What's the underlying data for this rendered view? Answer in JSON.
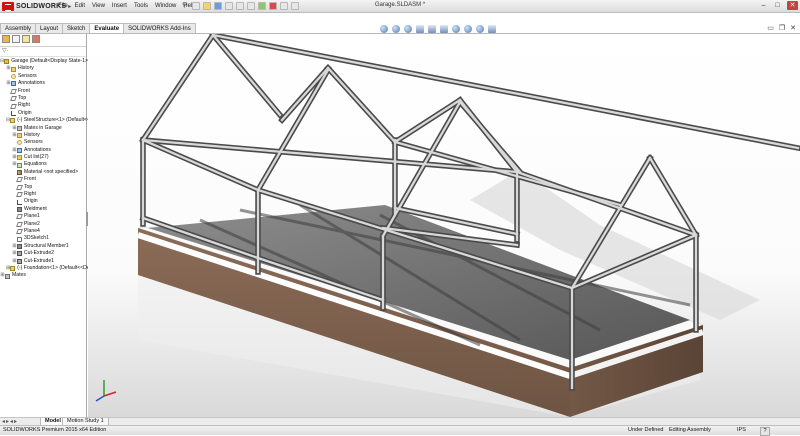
{
  "app": {
    "logo_text": "SOLIDWORKS",
    "document_title": "Garage.SLDASM *"
  },
  "menu": [
    "File",
    "Edit",
    "View",
    "Insert",
    "Tools",
    "Window",
    "Help"
  ],
  "command_tabs": [
    "Assembly",
    "Layout",
    "Sketch",
    "Evaluate",
    "SOLIDWORKS Add-Ins"
  ],
  "feature_tree": {
    "rows": [
      {
        "label": "Garage  (Default<Display State-1>)",
        "indent": 0,
        "icon": "asm",
        "toggle": "-"
      },
      {
        "label": "History",
        "indent": 1,
        "icon": "folder",
        "toggle": "+"
      },
      {
        "label": "Sensors",
        "indent": 1,
        "icon": "sensor",
        "toggle": ""
      },
      {
        "label": "Annotations",
        "indent": 1,
        "icon": "annot",
        "toggle": "+"
      },
      {
        "label": "Front",
        "indent": 1,
        "icon": "plane",
        "toggle": ""
      },
      {
        "label": "Top",
        "indent": 1,
        "icon": "plane",
        "toggle": ""
      },
      {
        "label": "Right",
        "indent": 1,
        "icon": "plane",
        "toggle": ""
      },
      {
        "label": "Origin",
        "indent": 1,
        "icon": "origin",
        "toggle": ""
      },
      {
        "label": "(-) SteelStructure<1> (Default<<Defa",
        "indent": 1,
        "icon": "part",
        "toggle": "-"
      },
      {
        "label": "Mates in Garage",
        "indent": 2,
        "icon": "mates",
        "toggle": "+"
      },
      {
        "label": "History",
        "indent": 2,
        "icon": "folder",
        "toggle": "+"
      },
      {
        "label": "Sensors",
        "indent": 2,
        "icon": "sensor",
        "toggle": ""
      },
      {
        "label": "Annotations",
        "indent": 2,
        "icon": "annot",
        "toggle": "+"
      },
      {
        "label": "Cut list(27)",
        "indent": 2,
        "icon": "folder",
        "toggle": "+"
      },
      {
        "label": "Equations",
        "indent": 2,
        "icon": "eq",
        "toggle": "+"
      },
      {
        "label": "Material <not specified>",
        "indent": 2,
        "icon": "mat",
        "toggle": ""
      },
      {
        "label": "Front",
        "indent": 2,
        "icon": "plane",
        "toggle": ""
      },
      {
        "label": "Top",
        "indent": 2,
        "icon": "plane",
        "toggle": ""
      },
      {
        "label": "Right",
        "indent": 2,
        "icon": "plane",
        "toggle": ""
      },
      {
        "label": "Origin",
        "indent": 2,
        "icon": "origin",
        "toggle": ""
      },
      {
        "label": "Weldment",
        "indent": 2,
        "icon": "weld",
        "toggle": ""
      },
      {
        "label": "Plane1",
        "indent": 2,
        "icon": "plane",
        "toggle": ""
      },
      {
        "label": "Plane2",
        "indent": 2,
        "icon": "plane",
        "toggle": ""
      },
      {
        "label": "Plane4",
        "indent": 2,
        "icon": "plane",
        "toggle": ""
      },
      {
        "label": "3DSketch1",
        "indent": 2,
        "icon": "sketch",
        "toggle": ""
      },
      {
        "label": "Structural Member1",
        "indent": 2,
        "icon": "weld",
        "toggle": "+"
      },
      {
        "label": "Cut-Extrude2",
        "indent": 2,
        "icon": "cut",
        "toggle": "+"
      },
      {
        "label": "Cut-Extrude1",
        "indent": 2,
        "icon": "cut",
        "toggle": "+"
      },
      {
        "label": "(-) Foundation<1> (Default<<Defaul",
        "indent": 1,
        "icon": "part",
        "toggle": "+"
      },
      {
        "label": "Mates",
        "indent": 0,
        "icon": "mates",
        "toggle": "+"
      }
    ]
  },
  "bottom_tabs": [
    "Model",
    "Motion Study 1"
  ],
  "status": {
    "product": "SOLIDWORKS Premium 2015 x64 Edition",
    "state": "Under Defined",
    "mode": "Editing Assembly",
    "units": "IPS",
    "help": "?"
  }
}
